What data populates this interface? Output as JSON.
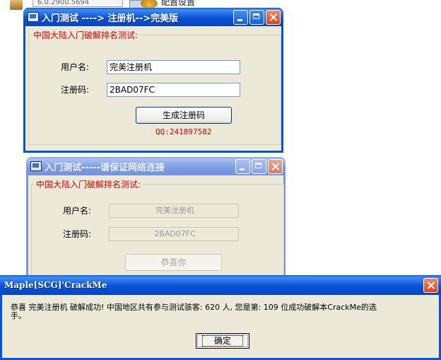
{
  "background": {
    "version_text": "6.0.2900.5694",
    "config_text": "配置设置"
  },
  "window1": {
    "title": "入门测试 ---->  注册机-->完美版",
    "group_title": "中国大陆入门破解排名测试:",
    "username_label": "用户名:",
    "username_value": "完美注册机",
    "code_label": "注册码:",
    "code_value": "2BAD07FC",
    "generate_button": "生成注册码",
    "qq_text": "QQ:241897582"
  },
  "window2": {
    "title": "入门测试-----请保证网络连接",
    "group_title": "中国大陆入门破解排名测试:",
    "username_label": "用户名:",
    "username_value": "完美注册机",
    "code_label": "注册码:",
    "code_value": "2BAD07FC",
    "congrats_button": "恭喜你"
  },
  "messagebox": {
    "title": "Maple[SCG]'CrackMe",
    "message_line1": "恭喜 完美注册机 破解成功! 中国地区共有参与测试骇客:  620 人, 您是第:  109 位成功破解本CrackMe的选",
    "message_line2": "手。",
    "ok_button": "确定"
  },
  "colors": {
    "title_active": "#0a52d6",
    "title_inactive": "#7d9be3",
    "group_label": "#e00000",
    "window_bg": "#ece9d8"
  }
}
